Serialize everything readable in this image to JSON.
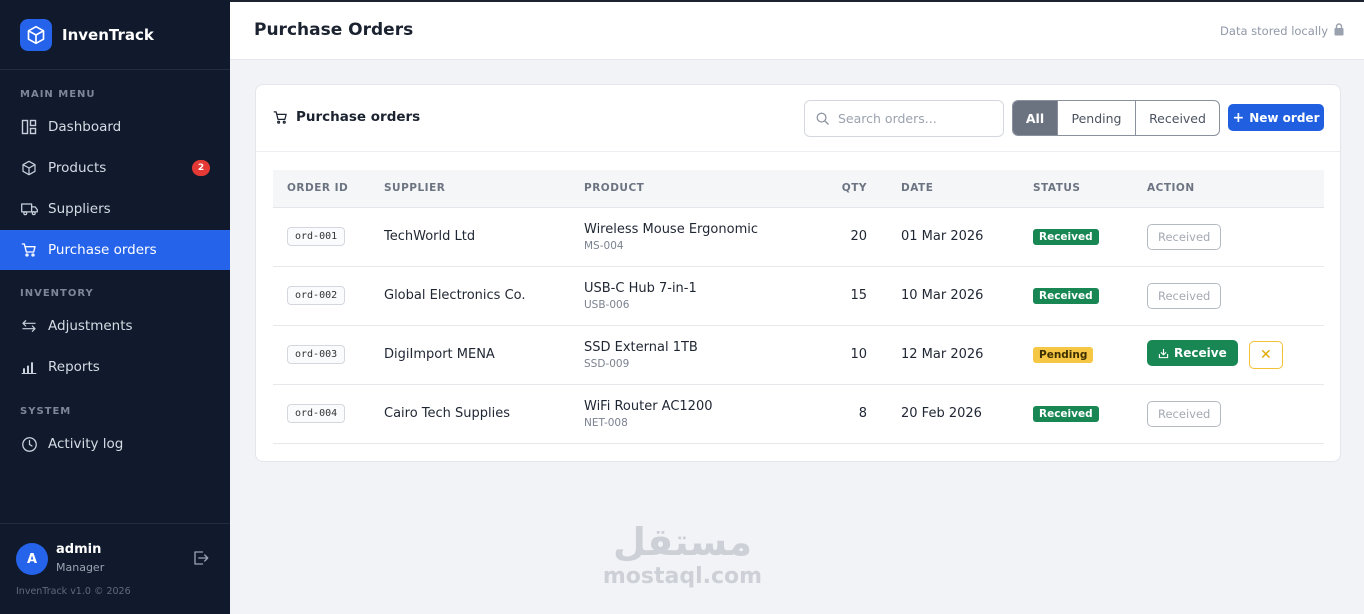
{
  "brand": {
    "name": "InvenTrack"
  },
  "sidebar": {
    "sections": [
      {
        "label": "MAIN MENU"
      },
      {
        "label": "INVENTORY"
      },
      {
        "label": "SYSTEM"
      }
    ],
    "items": [
      {
        "label": "Dashboard",
        "icon": "dashboard-icon"
      },
      {
        "label": "Products",
        "icon": "box-icon",
        "badge": "2"
      },
      {
        "label": "Suppliers",
        "icon": "truck-icon"
      },
      {
        "label": "Purchase orders",
        "icon": "cart-icon",
        "active": true
      },
      {
        "label": "Adjustments",
        "icon": "arrows-icon"
      },
      {
        "label": "Reports",
        "icon": "bar-chart-icon"
      },
      {
        "label": "Activity log",
        "icon": "clock-icon"
      }
    ],
    "user": {
      "initial": "A",
      "name": "admin",
      "role": "Manager"
    },
    "version": "InvenTrack v1.0 © 2026"
  },
  "header": {
    "title": "Purchase Orders",
    "storage_note": "Data stored locally"
  },
  "card": {
    "title": "Purchase orders",
    "search_placeholder": "Search orders...",
    "filters": [
      "All",
      "Pending",
      "Received"
    ],
    "active_filter": "All",
    "new_button": "New order"
  },
  "table": {
    "columns": [
      "ORDER ID",
      "SUPPLIER",
      "PRODUCT",
      "QTY",
      "DATE",
      "STATUS",
      "ACTION"
    ],
    "rows": [
      {
        "id": "ord-001",
        "supplier": "TechWorld Ltd",
        "product": "Wireless Mouse Ergonomic",
        "sku": "MS-004",
        "qty": "20",
        "date": "01 Mar 2026",
        "status": "Received",
        "action": "Received"
      },
      {
        "id": "ord-002",
        "supplier": "Global Electronics Co.",
        "product": "USB-C Hub 7-in-1",
        "sku": "USB-006",
        "qty": "15",
        "date": "10 Mar 2026",
        "status": "Received",
        "action": "Received"
      },
      {
        "id": "ord-003",
        "supplier": "DigiImport MENA",
        "product": "SSD External 1TB",
        "sku": "SSD-009",
        "qty": "10",
        "date": "12 Mar 2026",
        "status": "Pending",
        "action": "Receive"
      },
      {
        "id": "ord-004",
        "supplier": "Cairo Tech Supplies",
        "product": "WiFi Router AC1200",
        "sku": "NET-008",
        "qty": "8",
        "date": "20 Feb 2026",
        "status": "Received",
        "action": "Received"
      }
    ]
  },
  "watermark": {
    "arabic": "مستقل",
    "latin": "mostaql.com"
  },
  "colors": {
    "sidebar_bg": "#111a2c",
    "accent": "#2563eb",
    "success": "#198754",
    "warning": "#f6c744",
    "danger": "#e53935"
  }
}
